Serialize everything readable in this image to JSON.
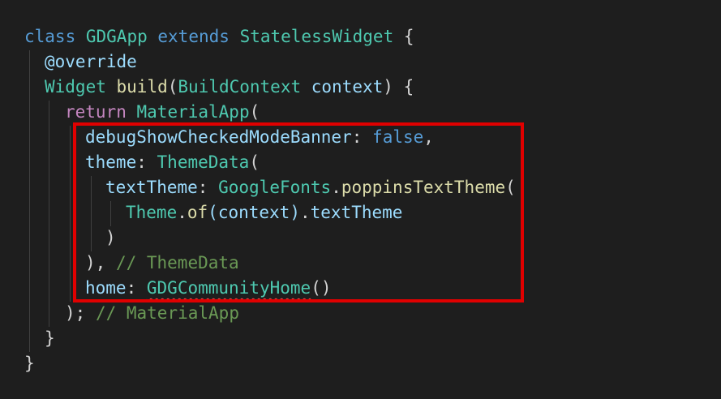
{
  "code": {
    "l1": {
      "kw": "class",
      "name": "GDGApp",
      "ext": "extends",
      "base": "StatelessWidget",
      "brace": "{"
    },
    "l2": {
      "annotation": "@override"
    },
    "l3": {
      "type": "Widget",
      "fn": "build",
      "paren_open": "(",
      "param_type": "BuildContext",
      "param": "context",
      "close": ") {"
    },
    "l4": {
      "kw": "return",
      "type": "MaterialApp",
      "paren": "("
    },
    "l5": {
      "prop": "debugShowCheckedModeBanner",
      "colon": ":",
      "value": "false",
      "comma": ","
    },
    "l6": {
      "prop": "theme",
      "colon": ":",
      "type": "ThemeData",
      "paren": "("
    },
    "l7": {
      "prop": "textTheme",
      "colon": ":",
      "cls": "GoogleFonts",
      "dot": ".",
      "fn": "poppinsTextTheme",
      "paren": "("
    },
    "l8": {
      "type": "Theme",
      "dot1": ".",
      "fn": "of",
      "args": "(context)",
      "dot2": ".",
      "prop": "textTheme"
    },
    "l9": {
      "text": ")"
    },
    "l10": {
      "text": "),",
      "comment": "// ThemeData"
    },
    "l11": {
      "prop": "home",
      "colon": ":",
      "type": "GDGCommunityHome",
      "call": "()"
    },
    "l12": {
      "text": ");",
      "comment": "// MaterialApp"
    },
    "l13": {
      "text": "}"
    },
    "l14": {
      "text": "}"
    }
  },
  "colors": {
    "background": "#1e1e1e",
    "highlight_border": "#e00000",
    "error_squiggle": "#f14c4c"
  }
}
